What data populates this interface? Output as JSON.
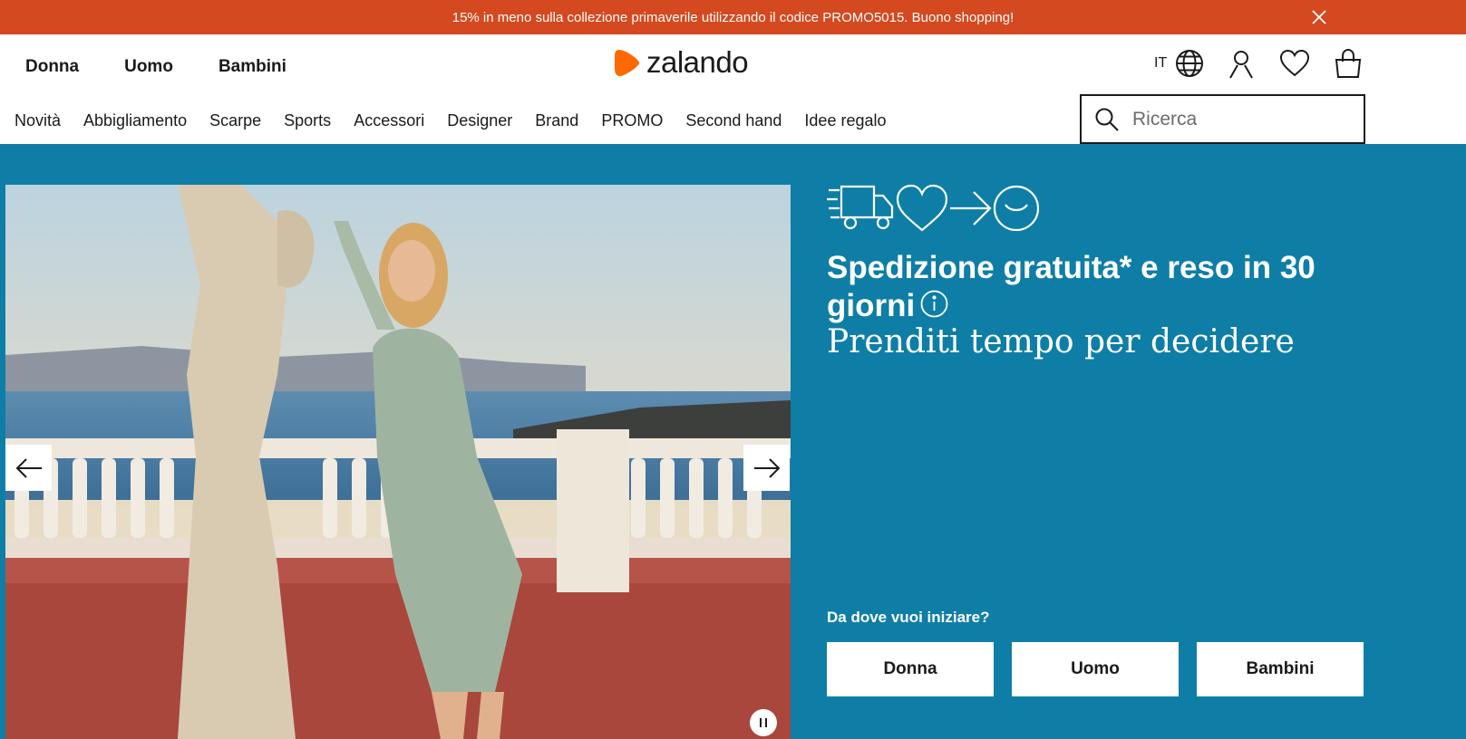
{
  "promo": {
    "text": "15% in meno sulla collezione primaverile utilizzando il codice PROMO5015. Buono shopping!",
    "close_icon": "close-icon"
  },
  "header": {
    "gender_nav": [
      "Donna",
      "Uomo",
      "Bambini"
    ],
    "logo_text": "zalando",
    "brand_color": "#ff6900",
    "language": "IT",
    "icons": [
      "globe-icon",
      "user-icon",
      "heart-icon",
      "bag-icon"
    ]
  },
  "categories": [
    "Novità",
    "Abbigliamento",
    "Scarpe",
    "Sports",
    "Accessori",
    "Designer",
    "Brand",
    "PROMO",
    "Second hand",
    "Idee regalo"
  ],
  "search": {
    "placeholder": "Ricerca"
  },
  "hero": {
    "background_color": "#0e7ea6",
    "banner_color": "#d4491f",
    "title": "Spedizione gratuita* e reso in 30 giorni",
    "subtitle": "Prenditi tempo per decidere",
    "start_question": "Da dove vuoi iniziare?",
    "start_buttons": [
      "Donna",
      "Uomo",
      "Bambini"
    ],
    "usp_icons": [
      "truck-icon",
      "heart-icon",
      "arrow-right-icon",
      "smile-icon"
    ]
  }
}
